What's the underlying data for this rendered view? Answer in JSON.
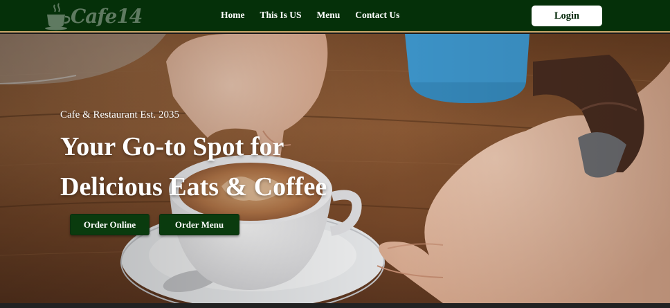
{
  "brand": {
    "name": "Cafe14",
    "icon": "coffee-cup-icon",
    "color": "#5f7a61"
  },
  "nav": {
    "links": [
      {
        "label": "Home"
      },
      {
        "label": "This Is US"
      },
      {
        "label": "Menu"
      },
      {
        "label": "Contact Us"
      }
    ],
    "login_label": "Login",
    "background": "#053009",
    "accent_border": "#c9a86a"
  },
  "hero": {
    "eyebrow": "Cafe & Restaurant Est. 2035",
    "headline_line1": "Your Go-to Spot for",
    "headline_line2": "Delicious Eats & Coffee",
    "buttons": {
      "order_online": "Order Online",
      "order_menu": "Order Menu"
    },
    "button_color": "#0a3b0e"
  }
}
